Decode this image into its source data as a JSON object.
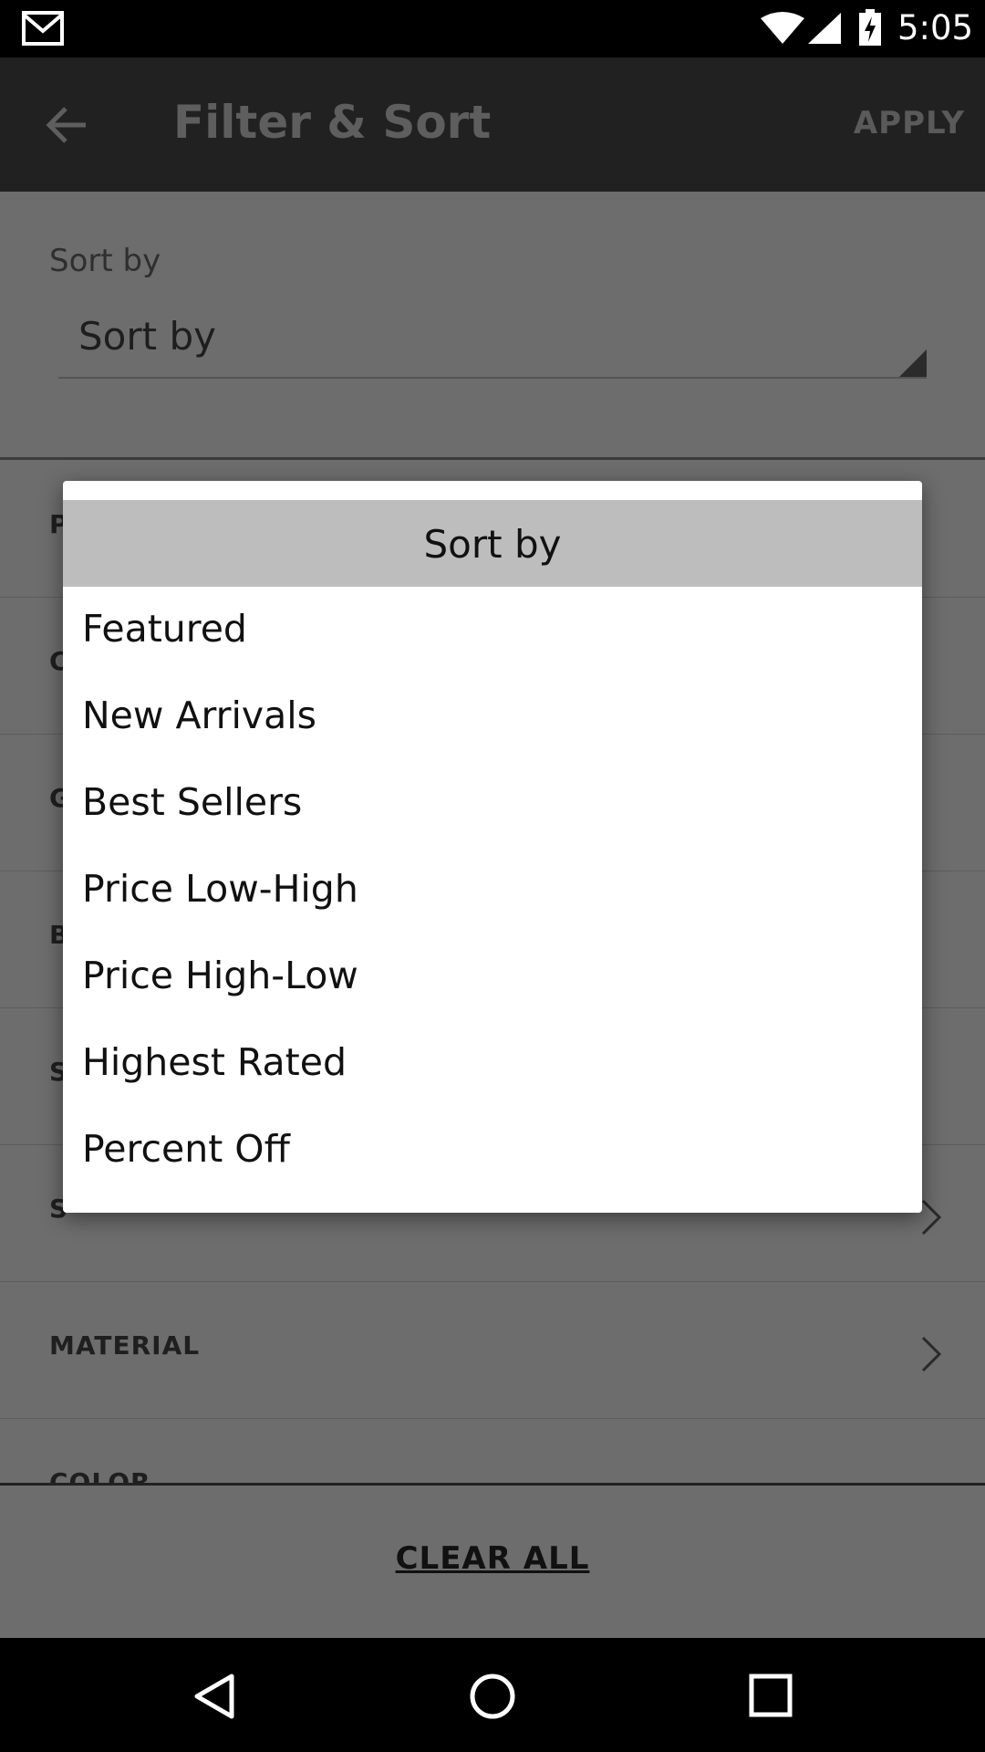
{
  "status_bar": {
    "time": "5:05",
    "icons": [
      "gmail-icon",
      "wifi-icon",
      "signal-icon",
      "battery-charging-icon"
    ]
  },
  "toolbar": {
    "title": "Filter & Sort",
    "apply_label": "APPLY",
    "back_icon": "back-arrow-icon"
  },
  "sort": {
    "section_label": "Sort by",
    "selected_value": "Sort by"
  },
  "filters": [
    {
      "label": "P"
    },
    {
      "label": "C"
    },
    {
      "label": "G"
    },
    {
      "label": "B"
    },
    {
      "label": "S"
    },
    {
      "label": "S"
    },
    {
      "label": "MATERIAL"
    },
    {
      "label": "COLOR"
    }
  ],
  "bottom": {
    "clear_all_label": "CLEAR ALL"
  },
  "dialog": {
    "title": "Sort by",
    "options": [
      "Featured",
      "New Arrivals",
      "Best Sellers",
      "Price Low-High",
      "Price High-Low",
      "Highest Rated",
      "Percent Off"
    ]
  },
  "nav_bar": {
    "icons": [
      "nav-back-icon",
      "nav-home-icon",
      "nav-recents-icon"
    ]
  },
  "colors": {
    "toolbar_bg": "#212121",
    "scrim_content": "#6d6d6d",
    "dialog_header_bg": "#bdbdbd",
    "dialog_bg": "#ffffff"
  }
}
